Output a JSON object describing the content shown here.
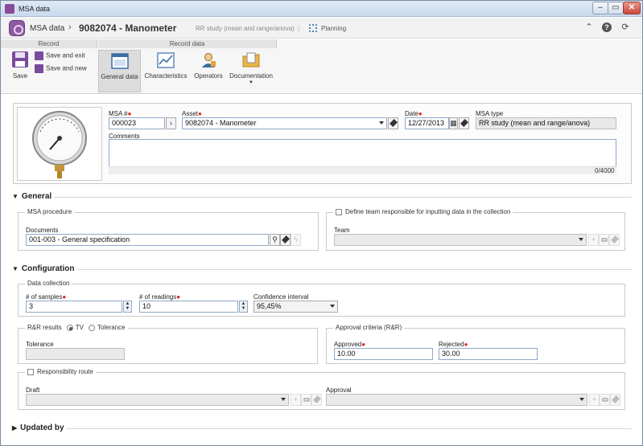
{
  "window": {
    "title": "MSA data",
    "min": "–",
    "max": "▭",
    "close": "✕"
  },
  "header": {
    "module": "MSA data",
    "separator": "›",
    "record": "9082074 - Manometer",
    "subtitle": "RR study (mean and range/anova)",
    "pipe": "|",
    "planning": "Planning",
    "collapse_glyph": "⌃",
    "help_glyph": "?",
    "refresh_glyph": "⟳"
  },
  "ribbon": {
    "group_record": "Record",
    "group_record_data": "Record data",
    "save": "Save",
    "save_exit": "Save and exit",
    "save_new": "Save and new",
    "general_data": "General data",
    "characteristics": "Characteristics",
    "operators": "Operators",
    "documentation": "Documentation"
  },
  "record": {
    "msa_label": "MSA #",
    "msa_value": "000023",
    "asset_label": "Asset",
    "asset_value": "9082074 - Manometer",
    "date_label": "Date",
    "date_value": "12/27/2013",
    "msa_type_label": "MSA type",
    "msa_type_value": "RR study (mean and range/anova)",
    "comments_label": "Comments",
    "comments_value": "",
    "counter": "0/4000",
    "required_mark": "●"
  },
  "general": {
    "title": "General",
    "msa_procedure": "MSA procedure",
    "documents_label": "Documents",
    "documents_value": "001-003 - General specification",
    "define_team": "Define team responsible for inputting data in the collection",
    "team_label": "Team",
    "team_value": ""
  },
  "configuration": {
    "title": "Configuration",
    "data_collection": "Data collection",
    "samples_label": "# of samples",
    "samples_value": "3",
    "readings_label": "# of readings",
    "readings_value": "10",
    "confidence_label": "Confidence interval",
    "confidence_value": "95,45%",
    "rr_results": "R&R results",
    "opt_tv": "TV",
    "opt_tolerance": "Tolerance",
    "tolerance_label": "Tolerance",
    "tolerance_value": "",
    "approval_criteria": "Approval criteria (R&R)",
    "approved_label": "Approved",
    "approved_value": "10.00",
    "rejected_label": "Rejected",
    "rejected_value": "30.00",
    "responsibility_route": "Responsibility route",
    "draft_label": "Draft",
    "draft_value": "",
    "approval_label": "Approval",
    "approval_value": ""
  },
  "updated_by": {
    "title": "Updated by"
  },
  "glyphs": {
    "next": "›",
    "search": "⚲",
    "plus": "+",
    "lightning": "ϟ",
    "calendar": "▦",
    "up": "▲",
    "down": "▼"
  },
  "colors": {
    "accent": "#8e5aa4",
    "required": "#dd2222",
    "input_border": "#8fa9c9"
  }
}
